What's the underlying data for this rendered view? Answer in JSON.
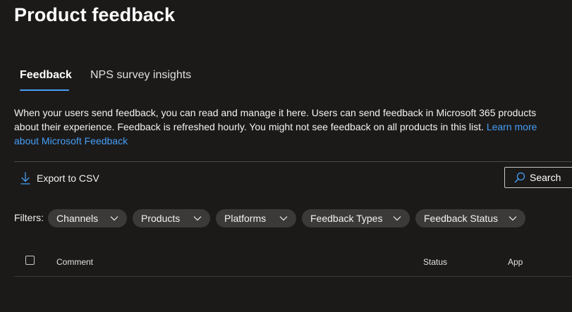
{
  "page": {
    "title": "Product feedback"
  },
  "tabs": [
    {
      "label": "Feedback",
      "active": true
    },
    {
      "label": "NPS survey insights",
      "active": false
    }
  ],
  "description": {
    "text": "When your users send feedback, you can read and manage it here. Users can send feedback in Microsoft 365 products about their experience. Feedback is refreshed hourly. You might not see feedback on all products in this list.",
    "link_text": "Learn more about Microsoft Feedback"
  },
  "toolbar": {
    "export_label": "Export to CSV",
    "export_icon": "download-arrow-icon",
    "search_placeholder": "Search",
    "search_icon": "search-icon"
  },
  "filters": {
    "label": "Filters:",
    "items": [
      {
        "label": "Channels"
      },
      {
        "label": "Products"
      },
      {
        "label": "Platforms"
      },
      {
        "label": "Feedback Types"
      },
      {
        "label": "Feedback Status"
      }
    ]
  },
  "table": {
    "columns": [
      {
        "label": "Comment"
      },
      {
        "label": "Status"
      },
      {
        "label": "App"
      }
    ],
    "rows": []
  },
  "colors": {
    "background": "#1b1a19",
    "accent": "#479ef5",
    "pill": "#3b3a39"
  }
}
